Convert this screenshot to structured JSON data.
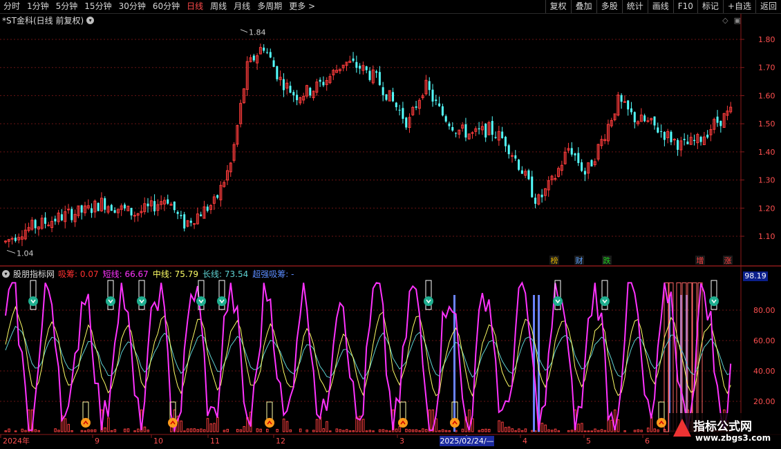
{
  "toolbar": {
    "periods": [
      "分时",
      "1分钟",
      "5分钟",
      "15分钟",
      "30分钟",
      "60分钟",
      "日线",
      "周线",
      "月线",
      "多周期",
      "更多 >"
    ],
    "active": "日线",
    "right": [
      "复权",
      "叠加",
      "多股",
      "统计",
      "画线",
      "F10",
      "标记",
      "+自选",
      "返回"
    ]
  },
  "stock": {
    "title": "*ST金科(日线 前复权)"
  },
  "price_axis": [
    "1.80",
    "1.70",
    "1.60",
    "1.50",
    "1.40",
    "1.30",
    "1.20",
    "1.10"
  ],
  "price_marks": {
    "high": "1.84",
    "low": "1.04"
  },
  "event_tags": [
    {
      "label": "榜",
      "color": "#e0b000"
    },
    {
      "label": "财",
      "color": "#5aa0ff"
    },
    {
      "label": "跌",
      "color": "#20d020"
    },
    {
      "label": "增",
      "color": "#ff4040"
    },
    {
      "label": "涨",
      "color": "#ff4040"
    }
  ],
  "indicator": {
    "name": "股朋指标网",
    "items": [
      {
        "label": "吸筹:",
        "value": "0.07",
        "color": "#ff3030"
      },
      {
        "label": "短线:",
        "value": "66.67",
        "color": "#ff33ff"
      },
      {
        "label": "中线:",
        "value": "75.79",
        "color": "#ffff66"
      },
      {
        "label": "长线:",
        "value": "73.54",
        "color": "#5fd3d3"
      },
      {
        "label": "超强吸筹:",
        "value": "-",
        "color": "#5b8cff"
      }
    ],
    "axis": [
      "80.00",
      "60.00",
      "40.00",
      "20.00"
    ],
    "current": "98.19"
  },
  "time_axis": [
    "2024年",
    "9",
    "10",
    "11",
    "12",
    "2",
    "3",
    "4",
    "5",
    "6"
  ],
  "cursor_date": "2025/02/24/—",
  "watermark": {
    "title": "指标公式网",
    "url": "www.zbgs3.com"
  },
  "chart_data": {
    "type": "candlestick",
    "price_ylim": [
      1.04,
      1.84
    ],
    "indicator_ylim": [
      0,
      100
    ],
    "series": [
      {
        "name": "短线",
        "color": "#ff33ff",
        "last": 66.67
      },
      {
        "name": "中线",
        "color": "#ffff66",
        "last": 75.79
      },
      {
        "name": "长线",
        "color": "#5fd3d3",
        "last": 73.54
      },
      {
        "name": "吸筹",
        "color": "#ff3030",
        "last": 0.07
      }
    ],
    "trend": [
      1.08,
      1.12,
      1.14,
      1.16,
      1.18,
      1.19,
      1.22,
      1.2,
      1.18,
      1.2,
      1.24,
      1.14,
      1.18,
      1.22,
      1.36,
      1.7,
      1.78,
      1.66,
      1.6,
      1.62,
      1.66,
      1.72,
      1.7,
      1.66,
      1.58,
      1.5,
      1.64,
      1.54,
      1.48,
      1.46,
      1.48,
      1.44,
      1.34,
      1.22,
      1.3,
      1.42,
      1.32,
      1.44,
      1.58,
      1.52,
      1.5,
      1.46,
      1.42,
      1.44,
      1.5,
      1.54
    ]
  }
}
